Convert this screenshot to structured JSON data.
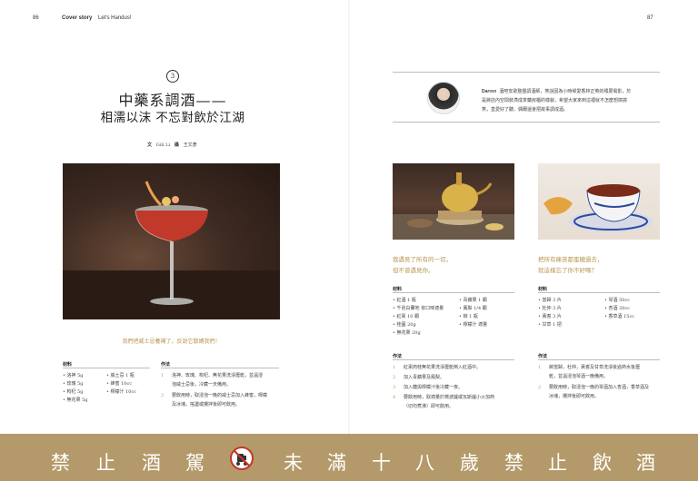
{
  "header": {
    "page_left": "86",
    "section": "Cover story",
    "subsection": "Let's Handus!",
    "page_right": "87"
  },
  "article": {
    "number": "3",
    "title_line1": "中藥系調酒——",
    "title_line2": "相濡以沫 不忘對飲於江湖",
    "byline_label_text": "文",
    "byline_author": "Gili Li",
    "byline_label_photo": "攝",
    "byline_photographer": "王文彥"
  },
  "profile": {
    "name": "Darren",
    "bio_line1": "酒吧安歌整團調酒師，笑說因為小時候愛香林正英的殭屍電影，於",
    "bio_line2": "是將店內空間裝潢成茶藥房櫃的樣貌，希望大家來到這裡就不怎麼想搞搞",
    "bio_line3": "笑，直愛好了聽，偶爾還會把故事調成酒。"
  },
  "recipe1": {
    "tagline": "我們把威士忌養補了，反說它散嬌我們！",
    "ingredients_heading": "材料",
    "ingredients_col1": [
      "• 洛神 5g",
      "• 玫瑰 5g",
      "• 枸杞 5g",
      "• 無花果 5g"
    ],
    "ingredients_col2": [
      "• 威士忌 1 瓶",
      "• 蜂蜜 10cc",
      "• 檸檬汁 10cc"
    ],
    "steps_heading": "作法",
    "steps": [
      {
        "n": "1",
        "lines": [
          "洛神、玫瑰、枸杞、無花果洗淨瀝乾，並溫浸",
          "泡威士忌後，冷藏一天備用。"
        ]
      },
      {
        "n": "2",
        "lines": [
          "要飲用時，取浸泡一晚的威士忌加入蜂蜜，檸檬",
          "及冰塊，搖盪或攪拌後即可飲用。"
        ]
      }
    ]
  },
  "recipe2": {
    "tagline_line1": "我遇見了所有的一切，",
    "tagline_line2": "但不曾遇見你。",
    "ingredients_heading": "材料",
    "ingredients_col1": [
      "• 紅酒 1 瓶",
      "• 千邑白蘭地 依口味適量",
      "• 紅棗 10 顆",
      "• 桂圓 20g",
      "• 無花果 20g"
    ],
    "ingredients_col2": [
      "• 青蘋果 1 顆",
      "• 鳳梨 1/4 顆",
      "• 柳 1 瓶",
      "• 檸檬汁 適量"
    ],
    "steps_heading": "作法",
    "steps": [
      {
        "n": "1",
        "lines": [
          "紅棗肉桂無花果洗淨瀝乾倒入紅酒中。"
        ]
      },
      {
        "n": "2",
        "lines": [
          "加入青蘋果及鳳梨。"
        ]
      },
      {
        "n": "3",
        "lines": [
          "加入糖與檸檬汁後冷藏一夜。"
        ]
      },
      {
        "n": "4",
        "lines": [
          "要飲用時，取適量於微波爐或瓦斯爐小火加熱",
          "（切勿煮沸）即可飲用。"
        ]
      }
    ]
  },
  "recipe3": {
    "tagline_line1": "把所有痛苦都蜜糖過去，",
    "tagline_line2": "就這樣忘了你不好嗎？",
    "ingredients_heading": "材料",
    "ingredients_col1": [
      "• 當歸 3 片",
      "• 杜仲 3 片",
      "• 黃耆 3 片",
      "• 甘草 1 把"
    ],
    "ingredients_col2": [
      "• 琴酒 50cc",
      "• 杏酒 20cc",
      "• 香草酒 15cc"
    ],
    "steps_heading": "作法",
    "steps": [
      {
        "n": "1",
        "lines": [
          "將當歸，杜仲，黃耆及甘草洗淨後過熱水後瀝",
          "乾，並溫浸泡琴酒一晚備用。"
        ]
      },
      {
        "n": "2",
        "lines": [
          "要飲用時，取浸泡一晚的琴酒加入杏酒，香草酒及",
          "冰塊，攪拌後即可飲用。"
        ]
      }
    ]
  },
  "banner": {
    "left_chars": [
      "禁",
      "止",
      "酒",
      "駕"
    ],
    "right_chars": [
      "未",
      "滿",
      "十",
      "八",
      "歲",
      "禁",
      "止",
      "飲",
      "酒"
    ],
    "icon": "no-drink-driving-icon",
    "color": "#b49a6a"
  }
}
